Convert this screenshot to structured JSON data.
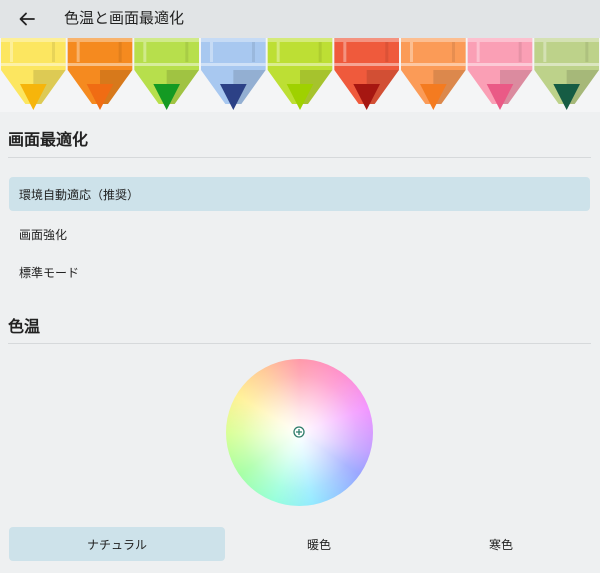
{
  "header": {
    "title": "色温と画面最適化"
  },
  "optimization": {
    "title": "画面最適化",
    "options": [
      {
        "label": "環境自動適応（推奨）",
        "selected": true
      },
      {
        "label": "画面強化",
        "selected": false
      },
      {
        "label": "標準モード",
        "selected": false
      }
    ]
  },
  "color_temp": {
    "title": "色温",
    "modes": [
      {
        "label": "ナチュラル",
        "selected": true
      },
      {
        "label": "暖色",
        "selected": false
      },
      {
        "label": "寒色",
        "selected": false
      }
    ]
  },
  "colors": {
    "selected_bg": "#cde2ea",
    "handle": "#2e7d6a",
    "crayons": [
      "#fce660",
      "#f58a1f",
      "#b7df4c",
      "#a8c8f0",
      "#bddf34",
      "#ef5a3c",
      "#fb9b57",
      "#fa9fb5",
      "#bdd28a"
    ],
    "crayon_tips": [
      "#f6b50b",
      "#f06c13",
      "#149a23",
      "#2c4186",
      "#9fd100",
      "#a61711",
      "#f47b20",
      "#ea5a86",
      "#165c44"
    ]
  },
  "icons": {
    "back": "back-arrow-icon",
    "handle": "plus-circle-icon"
  }
}
